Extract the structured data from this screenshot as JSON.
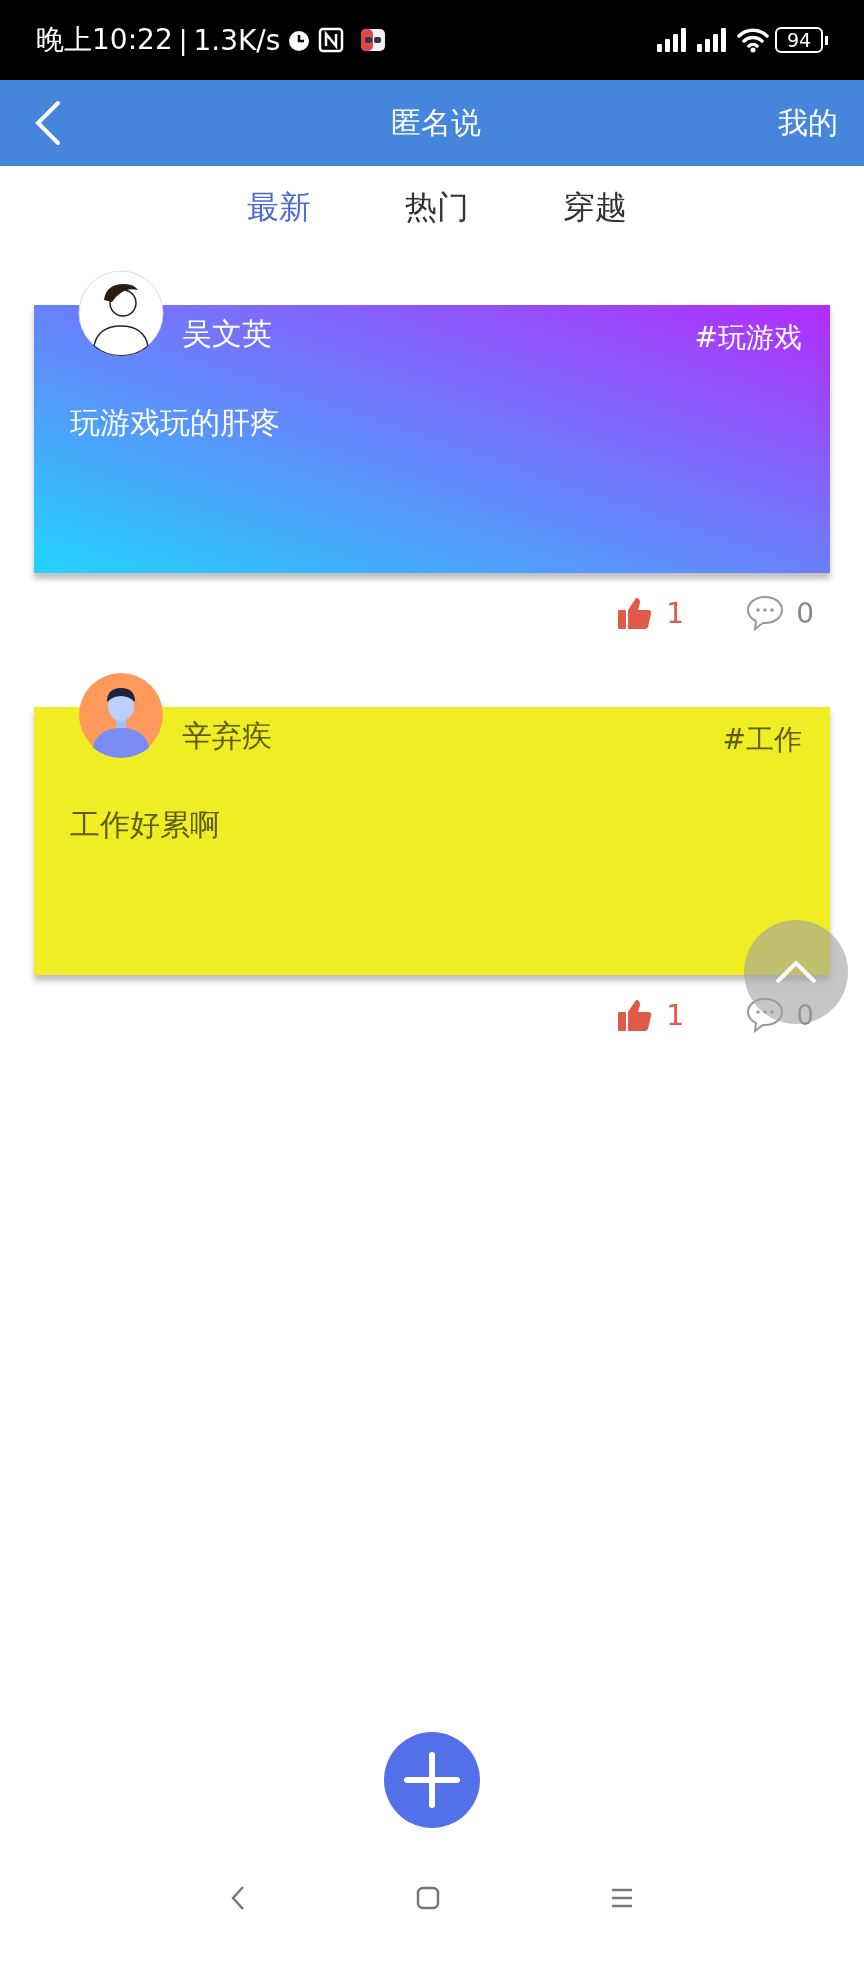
{
  "status_bar": {
    "time": "晚上10:22",
    "separator": "|",
    "speed": "1.3K/s",
    "battery": "94"
  },
  "header": {
    "title": "匿名说",
    "right_link": "我的"
  },
  "tabs": [
    {
      "label": "最新",
      "selected": true
    },
    {
      "label": "热门",
      "selected": false
    },
    {
      "label": "穿越",
      "selected": false
    }
  ],
  "posts": [
    {
      "author": "吴文英",
      "tag": "#玩游戏",
      "content": "玩游戏玩的肝疼",
      "kind": "gradient",
      "color": "#b22cfc",
      "likes": "1",
      "comments": "0"
    },
    {
      "author": "辛弃疾",
      "tag": "#工作",
      "content": "工作好累啊",
      "kind": "solid",
      "color": "#efee24",
      "likes": "1",
      "comments": "0"
    }
  ]
}
